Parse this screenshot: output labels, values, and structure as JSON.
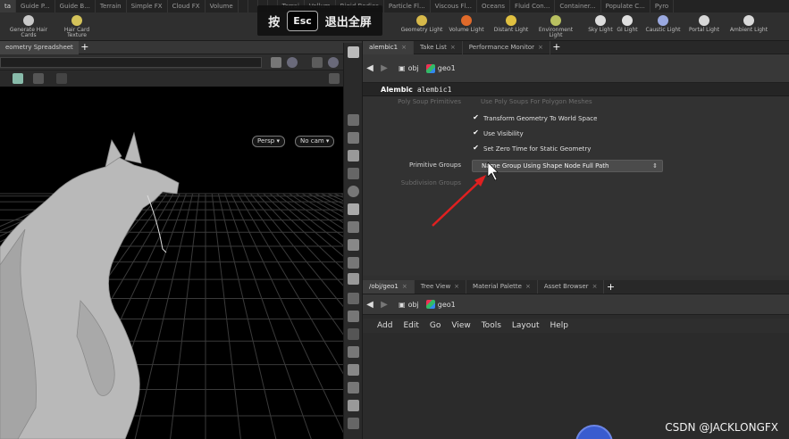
{
  "shelf_tabs": [
    "ta",
    "Guide P...",
    "Guide B...",
    "Terrain",
    "Simple FX",
    "Cloud FX",
    "Volume",
    "",
    "",
    "",
    "",
    "Terrai",
    "Vellum",
    "Rigid Bodies",
    "Particle Fl...",
    "Viscous Fl...",
    "Oceans",
    "Fluid Con...",
    "Container...",
    "Populate C...",
    "Pyro"
  ],
  "shelf_tools_left": [
    {
      "label": "Geometry Light"
    },
    {
      "label": "Volume Light"
    },
    {
      "label": "Distant Light"
    },
    {
      "label": "Environment Light"
    },
    {
      "label": "Sky Light"
    },
    {
      "label": "GI Light"
    },
    {
      "label": "Caustic Light"
    },
    {
      "label": "Portal Light"
    },
    {
      "label": "Ambient Light"
    }
  ],
  "shelf_tools_early": [
    {
      "label": "Generate Hair Cards"
    },
    {
      "label": "Hair Card Texture"
    }
  ],
  "esc_banner": {
    "prefix": "按",
    "key": "Esc",
    "suffix": "退出全屏"
  },
  "left_pane": {
    "tab_label": "eometry Spreadsheet",
    "view_menu_persp": "Persp ▾",
    "view_menu_cam": "No cam ▾"
  },
  "right_top_tabs": [
    {
      "label": "alembic1",
      "closable": true
    },
    {
      "label": "Take List",
      "closable": true
    },
    {
      "label": "Performance Monitor",
      "closable": true
    }
  ],
  "path_top": {
    "crumb1": "obj",
    "crumb2": "geo1"
  },
  "node_header": {
    "type": "Alembic",
    "name": "alembic1"
  },
  "params": {
    "faded_top_label": "Poly Soup Primitives",
    "faded_top_value": "Use Poly Soups For Polygon Meshes",
    "transform_label": "Transform Geometry To World Space",
    "visibility_label": "Use Visibility",
    "zero_time_label": "Set Zero Time for Static Geometry",
    "primitive_groups_label": "Primitive Groups",
    "primitive_groups_value": "Name Group Using Shape Node Full Path",
    "subdivision_groups_label": "Subdivision Groups"
  },
  "right_bottom_tabs": [
    {
      "label": "/obj/geo1",
      "closable": true
    },
    {
      "label": "Tree View",
      "closable": true
    },
    {
      "label": "Material Palette",
      "closable": true
    },
    {
      "label": "Asset Browser",
      "closable": true
    }
  ],
  "path_bottom": {
    "crumb1": "obj",
    "crumb2": "geo1"
  },
  "net_menu": [
    "Add",
    "Edit",
    "Go",
    "View",
    "Tools",
    "Layout",
    "Help"
  ],
  "watermark": "CSDN @JACKLONGFX",
  "colors": {
    "arrow": "#e02020",
    "panel": "#303030",
    "accent": "#3a5ccf"
  }
}
